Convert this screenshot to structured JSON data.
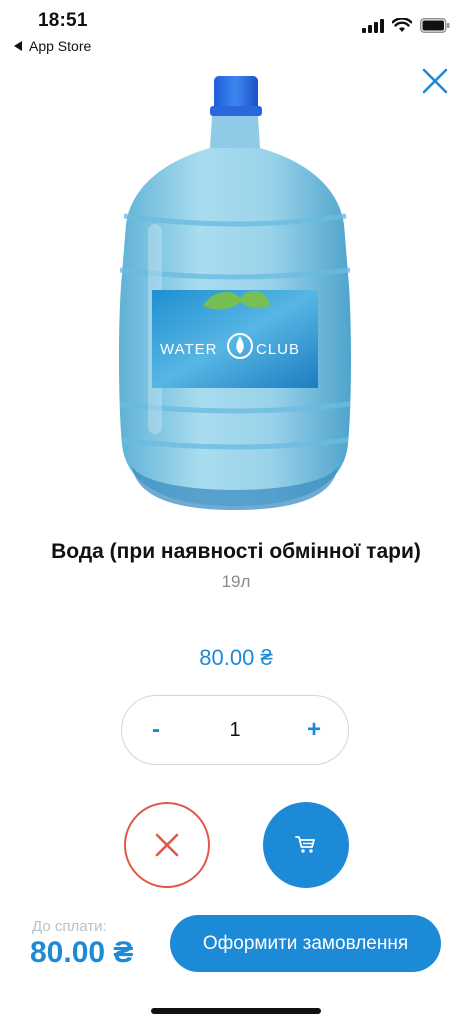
{
  "status_bar": {
    "time": "18:51",
    "back_app": "App Store"
  },
  "product": {
    "image_label": "WATER CLUB",
    "title": "Вода (при наявності обмінної тари)",
    "volume": "19л",
    "price": "80.00 ₴"
  },
  "stepper": {
    "minus_label": "-",
    "quantity": "1",
    "plus_label": "+"
  },
  "footer": {
    "total_label": "До сплати:",
    "total_value": "80.00 ₴",
    "order_button_label": "Оформити замовлення"
  },
  "colors": {
    "accent": "#1d8ad8",
    "cancel": "#e0584a",
    "muted": "#8a8a8a"
  },
  "icons": {
    "close": "close-icon",
    "cancel": "x-icon",
    "cart": "cart-icon",
    "signal": "cellular-signal-icon",
    "wifi": "wifi-icon",
    "battery": "battery-icon"
  }
}
